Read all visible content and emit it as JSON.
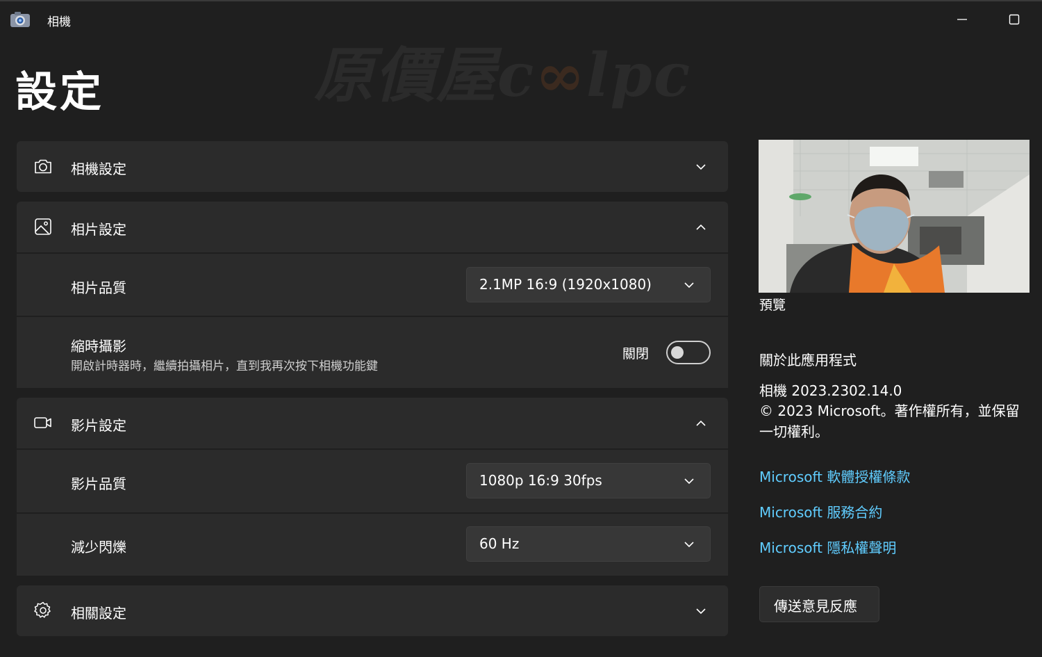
{
  "window": {
    "title": "相機",
    "icon": "camera-app-icon"
  },
  "watermark": {
    "text_prefix": "原價屋c",
    "text_oo": "∞",
    "text_suffix": "lpc"
  },
  "page": {
    "title": "設定"
  },
  "sections": {
    "camera": {
      "label": "相機設定",
      "icon": "camera-icon",
      "expanded": false
    },
    "photo": {
      "label": "相片設定",
      "icon": "image-icon",
      "expanded": true,
      "quality_label": "相片品質",
      "quality_value": "2.1MP 16:9 (1920x1080)",
      "timelapse_label": "縮時攝影",
      "timelapse_desc": "開啟計時器時，繼續拍攝相片，直到我再次按下相機功能鍵",
      "timelapse_state": "關閉",
      "timelapse_on": false
    },
    "video": {
      "label": "影片設定",
      "icon": "video-camera-icon",
      "expanded": true,
      "quality_label": "影片品質",
      "quality_value": "1080p 16:9 30fps",
      "flicker_label": "減少閃爍",
      "flicker_value": "60 Hz"
    },
    "related": {
      "label": "相關設定",
      "icon": "gear-icon",
      "expanded": false
    }
  },
  "sidebar": {
    "preview_label": "預覽",
    "about_title": "關於此應用程式",
    "version": "相機  2023.2302.14.0",
    "copyright": "© 2023 Microsoft。著作權所有，並保留一切權利。",
    "links": [
      "Microsoft 軟體授權條款",
      "Microsoft 服務合約",
      "Microsoft 隱私權聲明"
    ],
    "feedback_button": "傳送意見反應"
  },
  "colors": {
    "background": "#1f1f1f",
    "card": "#2b2b2b",
    "link": "#60cdff"
  }
}
